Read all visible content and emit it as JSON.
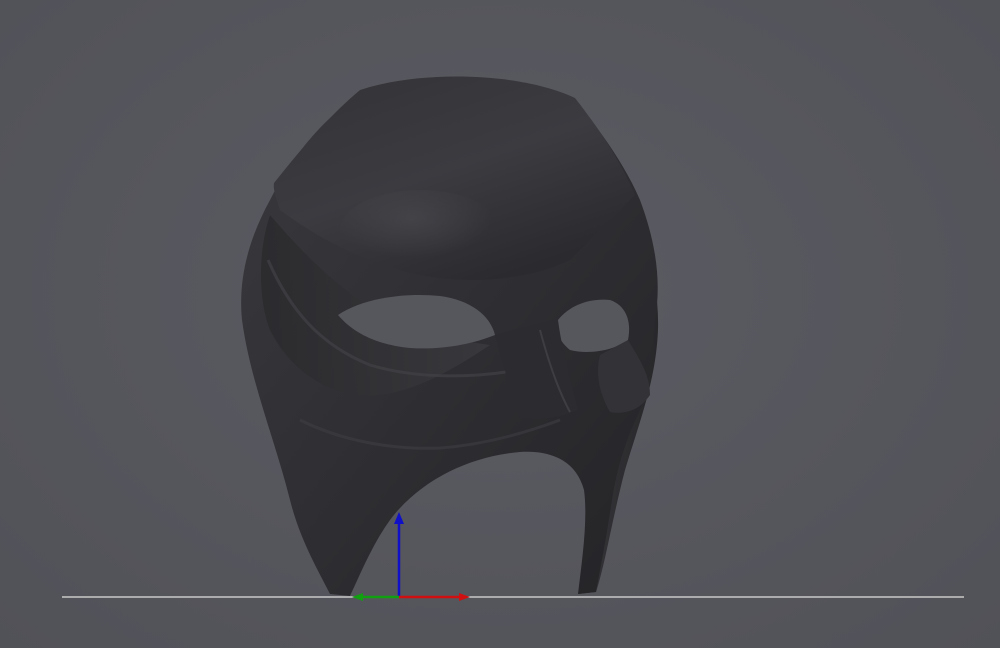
{
  "viewport": {
    "background_color": "#55555d",
    "model": {
      "name": "mask-model",
      "color": "#2e2e31"
    },
    "ground_plane": {
      "visible": true,
      "color": "#c8c8c8"
    },
    "axes_gizmo": {
      "x_axis_color": "#d01010",
      "y_axis_color": "#10a010",
      "z_axis_color": "#1010c8"
    }
  }
}
